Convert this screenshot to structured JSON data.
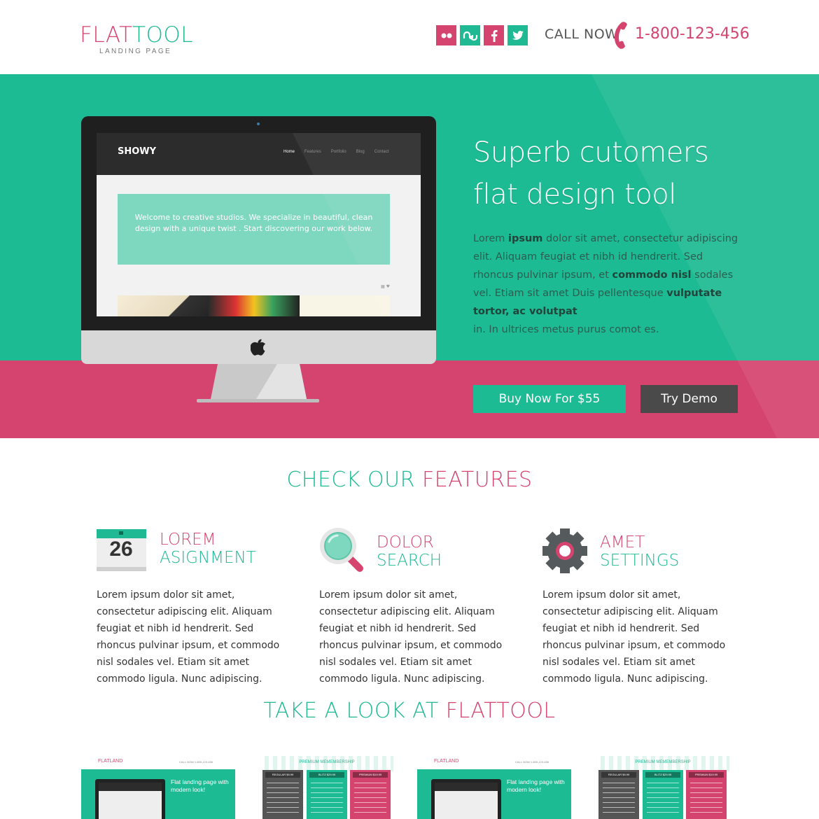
{
  "header": {
    "logo_part1": "FLAT",
    "logo_part2": "TOOL",
    "logo_subtitle": "LANDING PAGE",
    "social_icons": [
      "flickr-icon",
      "stumbleupon-icon",
      "facebook-icon",
      "twitter-icon"
    ],
    "call_label": "CALL NOW",
    "phone": "1-800-123-456"
  },
  "hero": {
    "title_line1": "Superb cutomers",
    "title_line2": "flat design tool",
    "body_1": "Lorem ",
    "body_b1": "ipsum",
    "body_2": " dolor sit amet, consectetur adipiscing elit. Aliquam feugiat et nibh id hendrerit. Sed rhoncus pulvinar ipsum, et ",
    "body_b2": "commodo nisl",
    "body_3": " sodales vel. Etiam sit amet Duis pellentesque ",
    "body_b3": "vulputate tortor, ac volutpat",
    "body_4": "in. In ultrices metus purus comot es.",
    "buy_label": "Buy Now For $55",
    "demo_label": "Try Demo"
  },
  "monitor_screen": {
    "brand": "SHOWY",
    "menu": [
      "Home",
      "Features",
      "Portfolio",
      "Blog",
      "Contact"
    ],
    "welcome": "Welcome to creative studios. We specialize in beautiful, clean design with a unique twist . Start discovering our work below."
  },
  "features": {
    "title_part1": "CHECK OUR",
    "title_part2": "FEATURES",
    "items": [
      {
        "title1": "LOREM",
        "title2": "ASIGNMENT",
        "icon": "calendar-icon",
        "date": "26",
        "desc": "Lorem ipsum dolor sit amet, consectetur adipiscing elit. Aliquam feugiat et nibh id hendrerit. Sed rhoncus pulvinar ipsum, et commodo nisl sodales vel. Etiam sit amet commodo ligula. Nunc adipiscing."
      },
      {
        "title1": "DOLOR",
        "title2": "SEARCH",
        "icon": "magnifier-icon",
        "desc": "Lorem ipsum dolor sit amet, consectetur adipiscing elit. Aliquam feugiat et nibh id hendrerit. Sed rhoncus pulvinar ipsum, et commodo nisl sodales vel. Etiam sit amet commodo ligula. Nunc adipiscing."
      },
      {
        "title1": "AMET",
        "title2": "SETTINGS",
        "icon": "gear-icon",
        "desc": "Lorem ipsum dolor sit amet, consectetur adipiscing elit. Aliquam feugiat et nibh id hendrerit. Sed rhoncus pulvinar ipsum, et commodo nisl sodales vel. Etiam sit amet commodo ligula. Nunc adipiscing."
      }
    ]
  },
  "look": {
    "title_part1": "TAKE A LOOK AT",
    "title_part2": "FLATTOOL",
    "thumb_landing_logo": "FLATLAND",
    "thumb_landing_call": "CALL NOW 1-800-123-456",
    "thumb_landing_text": "Flat landing page with modern look!",
    "thumb_pricing_title": "PREMIUM MEMEMBERSHIP",
    "thumb_pricing_prices": [
      "REGULAR $9.99",
      "BLITZ $29.99",
      "PREMIUM $19.99"
    ]
  },
  "colors": {
    "green": "#1dbb93",
    "pink": "#d4446f",
    "dark": "#4a4a4a"
  }
}
